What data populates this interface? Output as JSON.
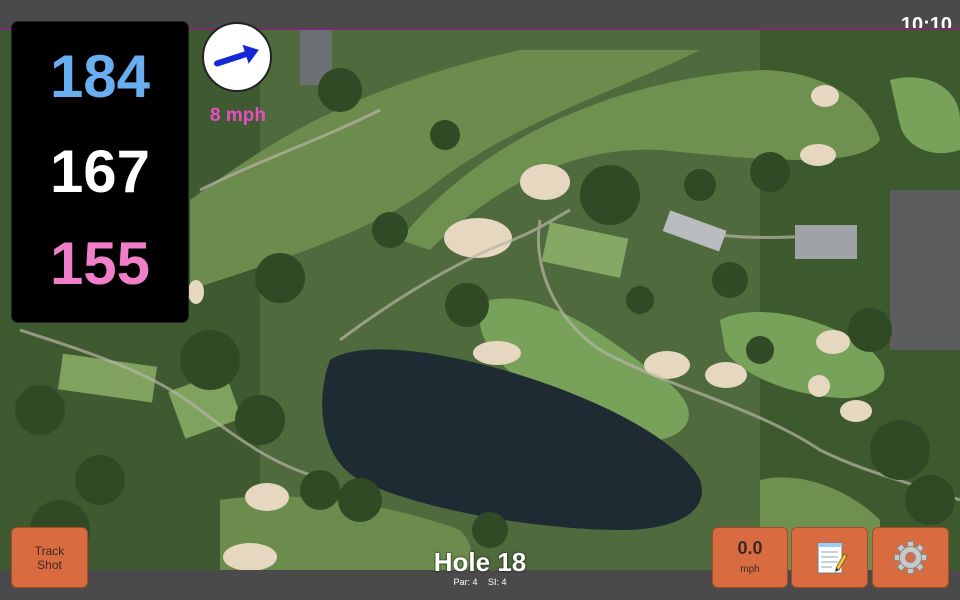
{
  "status": {
    "time": "10:10"
  },
  "distances": {
    "back": "184",
    "middle": "167",
    "front": "155"
  },
  "wind": {
    "speed_label": "8 mph",
    "direction": "east-north-east",
    "icon": "wind-arrow-icon"
  },
  "hole": {
    "title": "Hole 18",
    "par_label": "Par: 4",
    "si_label": "SI: 4"
  },
  "buttons": {
    "track_line1": "Track",
    "track_line2": "Shot",
    "speed_value": "0.0",
    "speed_unit": "mph",
    "notes_icon": "notepad-icon",
    "settings_icon": "gear-icon"
  },
  "colors": {
    "back_distance": "#6aaef2",
    "middle_distance": "#ffffff",
    "front_distance": "#f07ec8",
    "wind_text": "#e64fc4",
    "button": "#d96b40",
    "water": "#1f2b33"
  }
}
